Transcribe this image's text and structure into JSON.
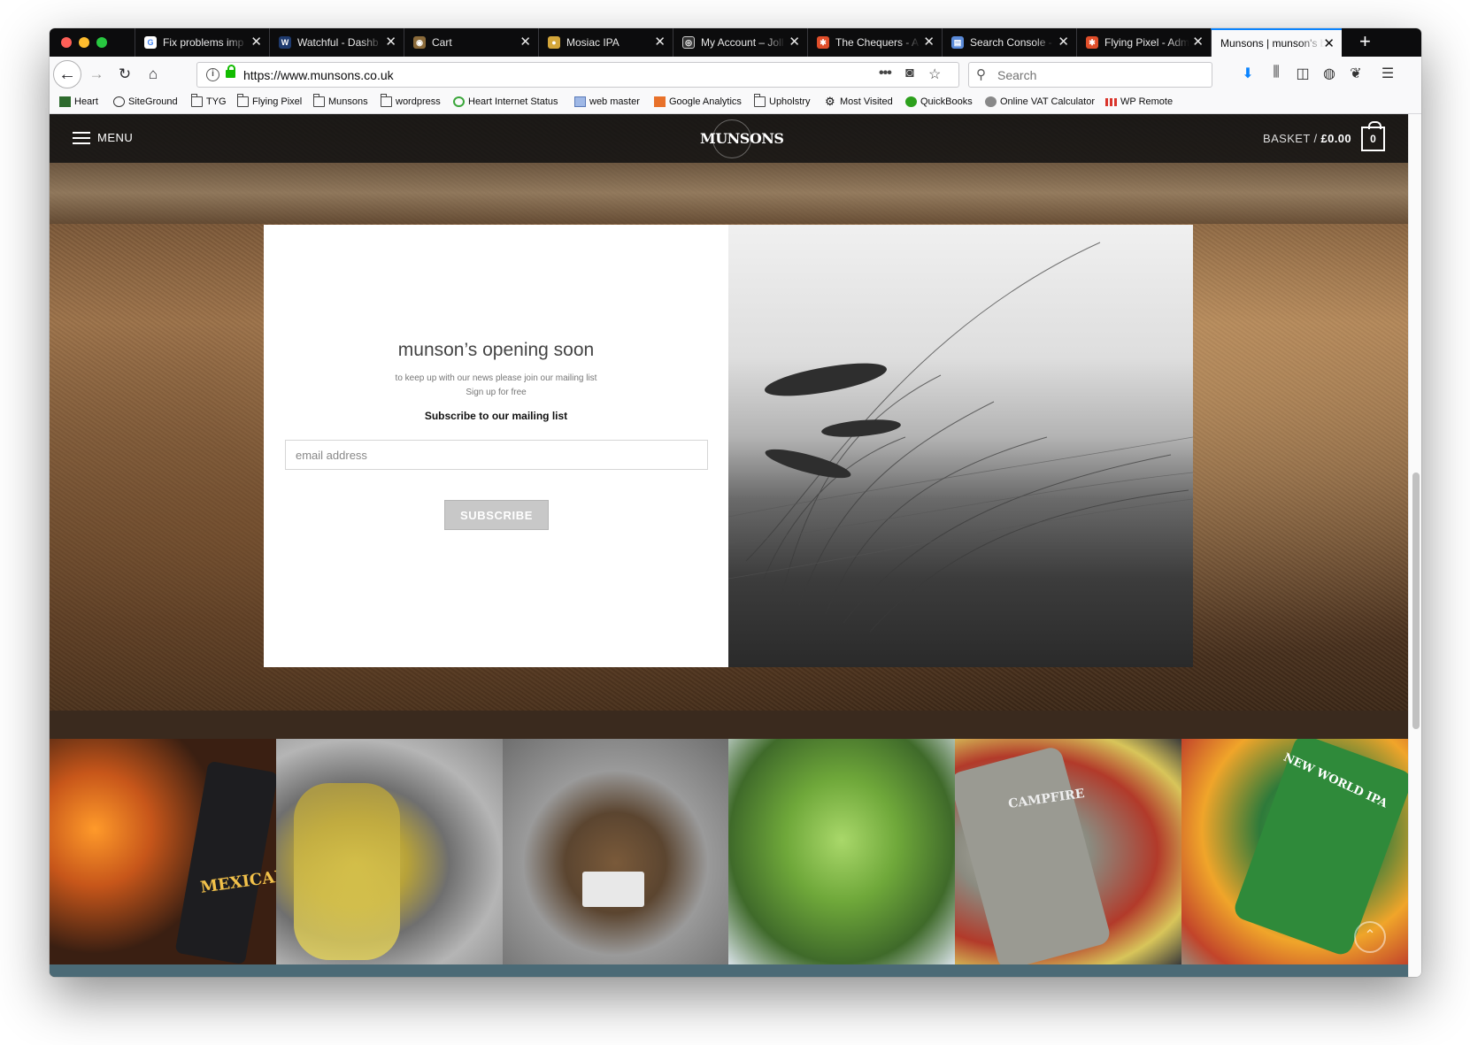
{
  "browser": {
    "tabs": [
      {
        "title": "Fix problems imp",
        "favicon_color": "#4285f4",
        "favicon_glyph": "G"
      },
      {
        "title": "Watchful - Dashb",
        "favicon_color": "#1e3a6e",
        "favicon_glyph": "W"
      },
      {
        "title": "Cart",
        "favicon_color": "#8a6a3a",
        "favicon_glyph": "◉"
      },
      {
        "title": "Mosiac IPA",
        "favicon_color": "#d4a63a",
        "favicon_glyph": "●"
      },
      {
        "title": "My Account – Joll",
        "favicon_color": "#333333",
        "favicon_glyph": "◎"
      },
      {
        "title": "The Chequers - A",
        "favicon_color": "#e04e2a",
        "favicon_glyph": "✱"
      },
      {
        "title": "Search Console -",
        "favicon_color": "#5a8ad8",
        "favicon_glyph": "▤"
      },
      {
        "title": "Flying Pixel - Adm",
        "favicon_color": "#e04e2a",
        "favicon_glyph": "✱"
      },
      {
        "title": "Munsons | munson's b",
        "favicon_color": "",
        "favicon_glyph": ""
      }
    ],
    "new_tab": "+",
    "url": "https://www.munsons.co.uk",
    "search_placeholder": "Search",
    "bookmarks": [
      {
        "label": "Heart",
        "icon": "heart-icon"
      },
      {
        "label": "SiteGround",
        "icon": "siteground-icon"
      },
      {
        "label": "TYG",
        "icon": "folder-icon"
      },
      {
        "label": "Flying Pixel",
        "icon": "folder-icon"
      },
      {
        "label": "Munsons",
        "icon": "folder-icon"
      },
      {
        "label": "wordpress",
        "icon": "folder-icon"
      },
      {
        "label": "Heart Internet Status",
        "icon": "status-icon"
      },
      {
        "label": "web master",
        "icon": "webmaster-icon"
      },
      {
        "label": "Google Analytics",
        "icon": "analytics-icon"
      },
      {
        "label": "Upholstry",
        "icon": "folder-icon"
      },
      {
        "label": "Most Visited",
        "icon": "gear-icon"
      },
      {
        "label": "QuickBooks",
        "icon": "quickbooks-icon"
      },
      {
        "label": "Online VAT Calculator",
        "icon": "globe-icon"
      },
      {
        "label": "WP Remote",
        "icon": "wpremote-icon"
      }
    ]
  },
  "site": {
    "menu_label": "MENU",
    "logo_text": "MUNSONS",
    "basket_label": "BASKET /",
    "basket_total": "£0.00",
    "basket_count": "0"
  },
  "popup": {
    "title": "munson’s opening soon",
    "subtitle_line1": "to keep up with our news please join our mailing list",
    "subtitle_line2": "Sign up for free",
    "heading": "Subscribe to our mailing list",
    "email_placeholder": "email address",
    "subscribe_label": "SUBSCRIBE"
  },
  "instagram": {
    "tile_texts": [
      "MEXICAKE",
      "",
      "",
      "",
      "CAMPFIRE",
      "NEW WORLD IPA"
    ]
  },
  "colors": {
    "active_tab_accent": "#0a84ff",
    "footer_band": "#4b6a76",
    "secure_lock": "#12bc00"
  }
}
